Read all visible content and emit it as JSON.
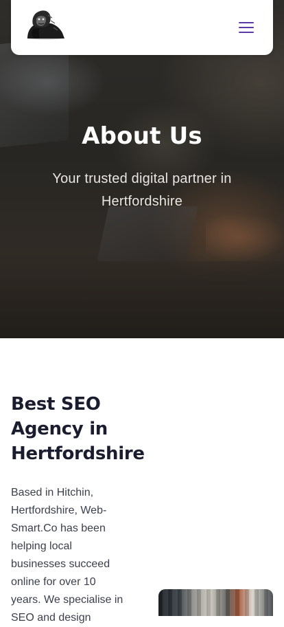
{
  "header": {
    "logo_icon": "gorilla-logo-icon",
    "menu_icon": "hamburger-menu-icon",
    "accent_color": "#5b3aa8"
  },
  "hero": {
    "title": "About Us",
    "subtitle": "Your trusted digital partner in Hertfordshire"
  },
  "intro": {
    "heading": "Best SEO Agency in Hertfordshire",
    "body": "Based in Hitchin, Hertfordshire, Web-Smart.Co has been helping local businesses succeed online for over 10 years. We specialise in SEO and design"
  },
  "colors": {
    "heading": "#1a1d2e",
    "body_text": "#3b3f4c",
    "hero_text": "#ffffff"
  }
}
